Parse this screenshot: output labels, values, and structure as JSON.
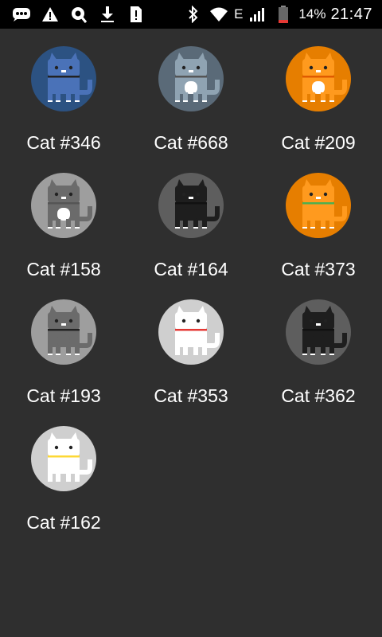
{
  "status_bar": {
    "network": "E",
    "battery": "14%",
    "time": "21:47"
  },
  "cats": [
    {
      "label": "Cat #346",
      "bg": "#2c5282",
      "body": "#4a72b8",
      "chest": "#4a72b8",
      "collar": "#222222"
    },
    {
      "label": "Cat #668",
      "bg": "#5a6a78",
      "body": "#8fa3b2",
      "chest": "#ffffff",
      "collar": "#555555"
    },
    {
      "label": "Cat #209",
      "bg": "#e67e00",
      "body": "#ff9a1e",
      "chest": "#ffffff",
      "collar": "#e05a00"
    },
    {
      "label": "Cat #158",
      "bg": "#9e9e9e",
      "body": "#6b6b6b",
      "chest": "#ffffff",
      "collar": "#555555"
    },
    {
      "label": "Cat #164",
      "bg": "#5e5e5e",
      "body": "#1e1e1e",
      "chest": "#1e1e1e",
      "collar": "#111111"
    },
    {
      "label": "Cat #373",
      "bg": "#e67e00",
      "body": "#ff9a1e",
      "chest": "#ff9a1e",
      "collar": "#4caf50"
    },
    {
      "label": "Cat #193",
      "bg": "#9e9e9e",
      "body": "#6b6b6b",
      "chest": "#6b6b6b",
      "collar": "#222222"
    },
    {
      "label": "Cat #353",
      "bg": "#cfcfcf",
      "body": "#ffffff",
      "chest": "#ffffff",
      "collar": "#e53935"
    },
    {
      "label": "Cat #362",
      "bg": "#5e5e5e",
      "body": "#1e1e1e",
      "chest": "#1e1e1e",
      "collar": "#111111"
    },
    {
      "label": "Cat #162",
      "bg": "#cfcfcf",
      "body": "#ffffff",
      "chest": "#ffffff",
      "collar": "#fdd835"
    }
  ],
  "icons": {
    "status_left": [
      "message-icon",
      "warning-icon",
      "search-sync-icon",
      "download-icon",
      "sim-alert-icon"
    ],
    "status_right": [
      "bluetooth-icon",
      "wifi-icon",
      "signal-icon",
      "battery-icon"
    ]
  }
}
